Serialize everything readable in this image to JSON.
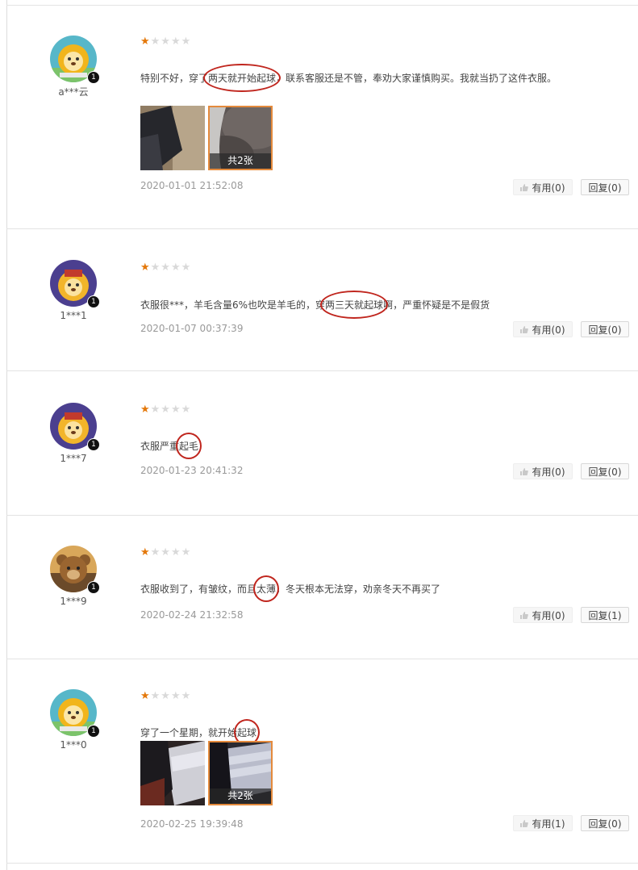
{
  "colors": {
    "star_on": "#e4780a",
    "star_off": "#d9d9d9",
    "circle": "#c0261e",
    "thumb_border": "#e48a3c"
  },
  "reviews": [
    {
      "user": "a***云",
      "badge": "1",
      "rating": 1,
      "content_parts": [
        "特别不好，穿了",
        "两天就开始起球",
        "，联系客服还是不管，奉劝大家谨慎购买。我就当扔了这件衣服。"
      ],
      "photo_count_label": "共2张",
      "date": "2020-01-01 21:52:08",
      "useful_label": "有用(0)",
      "reply_label": "回复(0)"
    },
    {
      "user": "1***1",
      "badge": "1",
      "rating": 1,
      "content_parts": [
        "衣服很***，羊毛含量6%也吹是羊毛的，穿",
        "两三天就起球",
        "啊，严重怀疑是不是假货"
      ],
      "date": "2020-01-07 00:37:39",
      "useful_label": "有用(0)",
      "reply_label": "回复(0)"
    },
    {
      "user": "1***7",
      "badge": "1",
      "rating": 1,
      "content_parts": [
        "衣服严重",
        "起毛",
        ""
      ],
      "date": "2020-01-23 20:41:32",
      "useful_label": "有用(0)",
      "reply_label": "回复(0)"
    },
    {
      "user": "1***9",
      "badge": "1",
      "rating": 1,
      "content_parts": [
        "衣服收到了，有皱纹，而且",
        "太薄",
        "，冬天根本无法穿，劝亲冬天不再买了"
      ],
      "date": "2020-02-24 21:32:58",
      "useful_label": "有用(0)",
      "reply_label": "回复(1)"
    },
    {
      "user": "1***0",
      "badge": "1",
      "rating": 1,
      "content_parts": [
        "穿了一个星期，就开始",
        "起球",
        ""
      ],
      "photo_count_label": "共2张",
      "date": "2020-02-25 19:39:48",
      "useful_label": "有用(1)",
      "reply_label": "回复(0)"
    }
  ]
}
